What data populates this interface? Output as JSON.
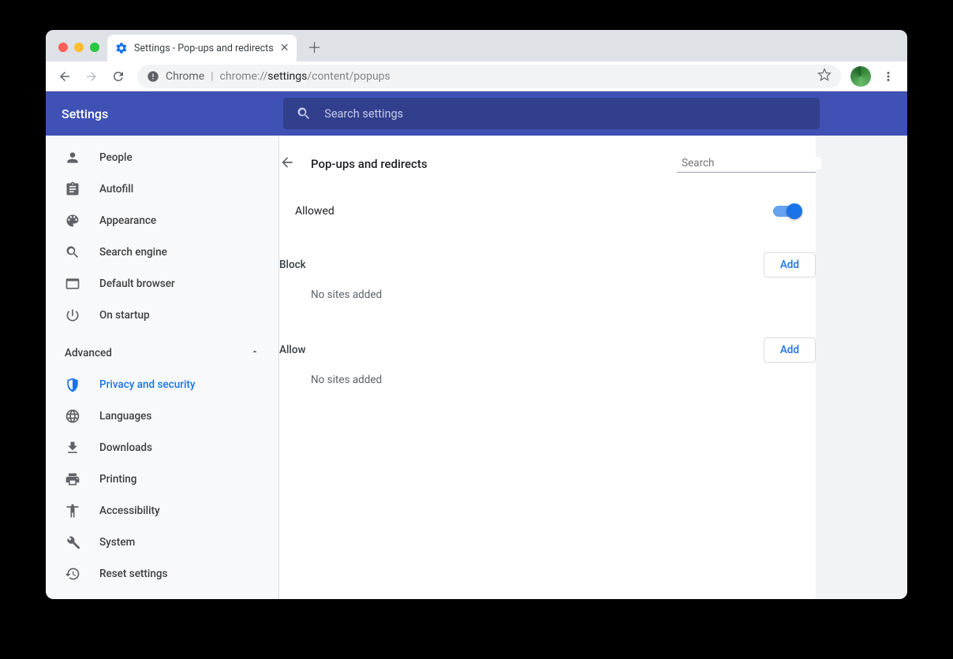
{
  "tab": {
    "title": "Settings - Pop-ups and redirects"
  },
  "url": {
    "secure_label": "Chrome",
    "prefix": "chrome://",
    "bold": "settings",
    "rest": "/content/popups"
  },
  "header": {
    "title": "Settings",
    "search_placeholder": "Search settings"
  },
  "sidebar": {
    "items": [
      {
        "label": "People"
      },
      {
        "label": "Autofill"
      },
      {
        "label": "Appearance"
      },
      {
        "label": "Search engine"
      },
      {
        "label": "Default browser"
      },
      {
        "label": "On startup"
      }
    ],
    "advanced_label": "Advanced",
    "advanced_items": [
      {
        "label": "Privacy and security"
      },
      {
        "label": "Languages"
      },
      {
        "label": "Downloads"
      },
      {
        "label": "Printing"
      },
      {
        "label": "Accessibility"
      },
      {
        "label": "System"
      },
      {
        "label": "Reset settings"
      }
    ]
  },
  "page": {
    "title": "Pop-ups and redirects",
    "local_search_placeholder": "Search",
    "allowed_label": "Allowed",
    "sections": {
      "block": {
        "label": "Block",
        "add_label": "Add",
        "empty": "No sites added"
      },
      "allow": {
        "label": "Allow",
        "add_label": "Add",
        "empty": "No sites added"
      }
    }
  }
}
